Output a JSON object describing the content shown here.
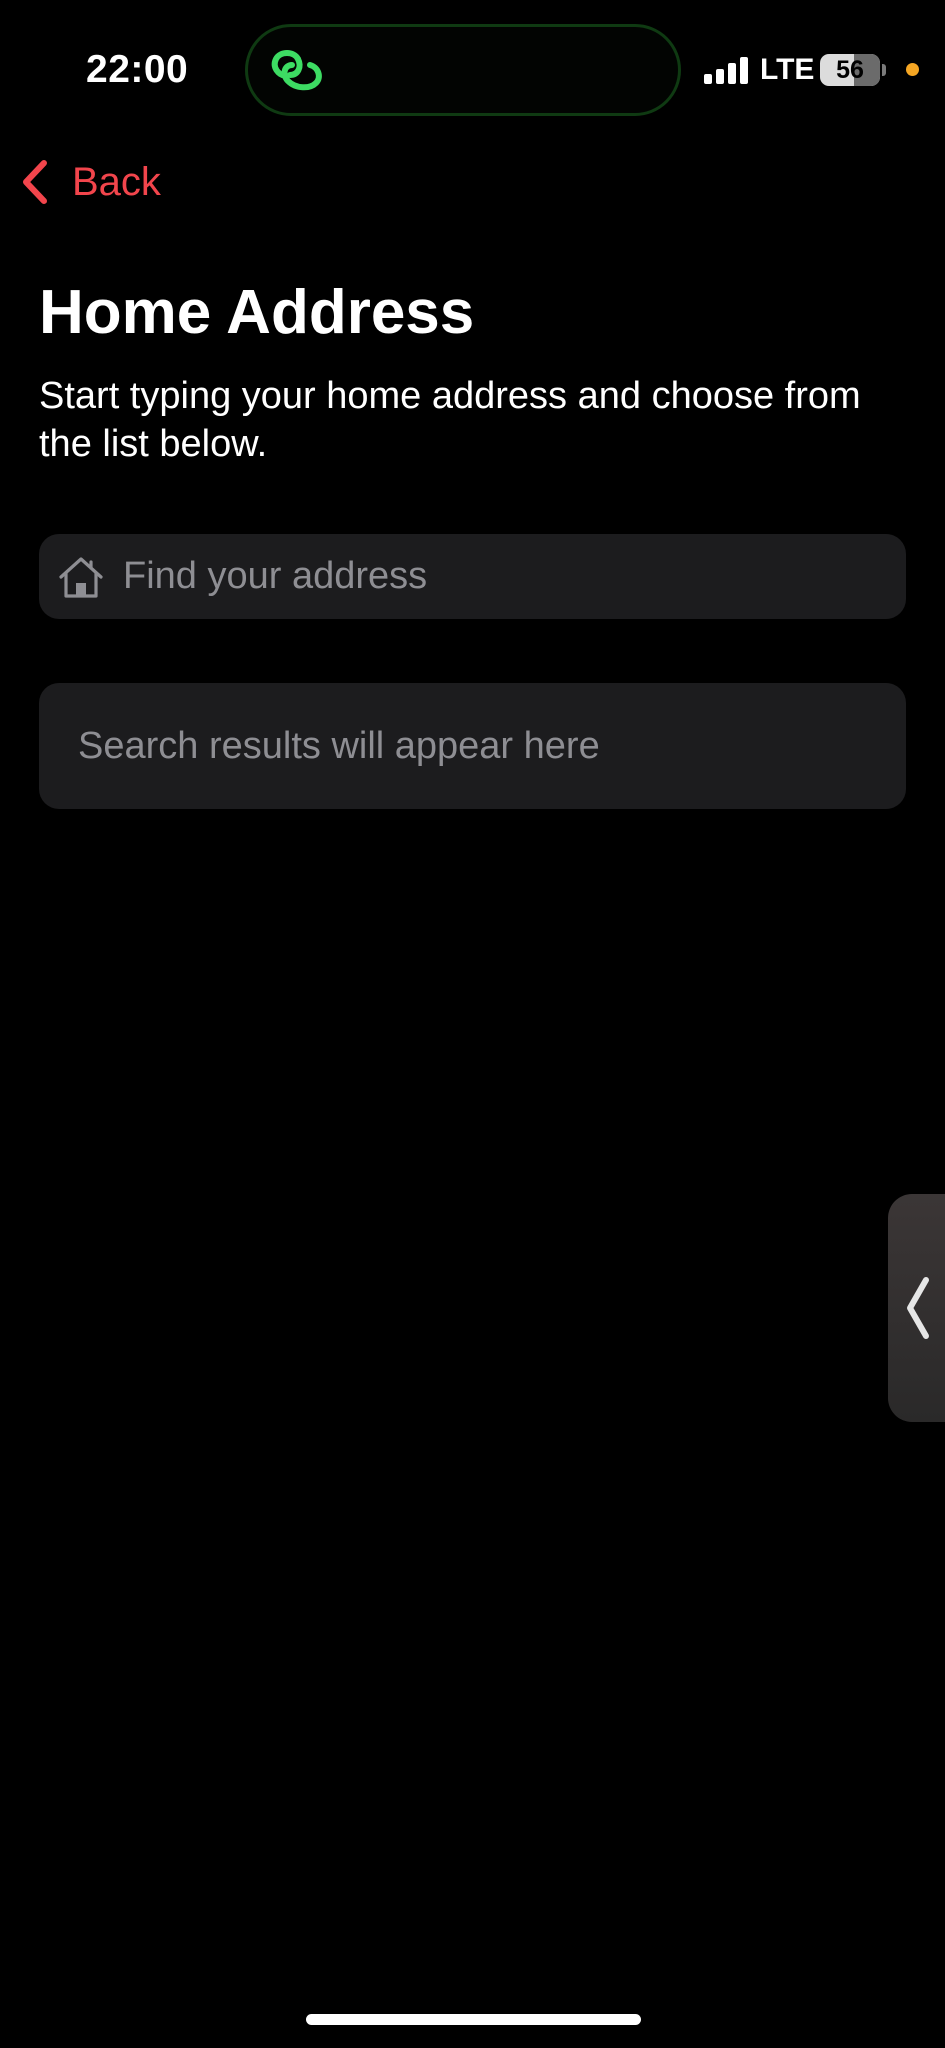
{
  "status_bar": {
    "time": "22:00",
    "network": "LTE",
    "battery_level": "56",
    "battery_fraction": 0.56,
    "privacy_dot_color": "#f5a623",
    "island_icon": "linked-rings-icon",
    "island_icon_color": "#3ddc63"
  },
  "nav": {
    "back_label": "Back",
    "back_icon": "chevron-left-icon",
    "accent_color": "#f2454c"
  },
  "page": {
    "title": "Home Address",
    "subtitle": "Start typing your home address and choose from the list below."
  },
  "search": {
    "icon": "home-icon",
    "placeholder": "Find your address",
    "value": ""
  },
  "results": {
    "empty_text": "Search results will appear here"
  },
  "side_tab": {
    "icon": "chevron-left-icon"
  },
  "colors": {
    "background": "#000000",
    "surface": "#1c1c1e",
    "primary_text": "#ffffff",
    "secondary_text": "#8e8e93"
  }
}
